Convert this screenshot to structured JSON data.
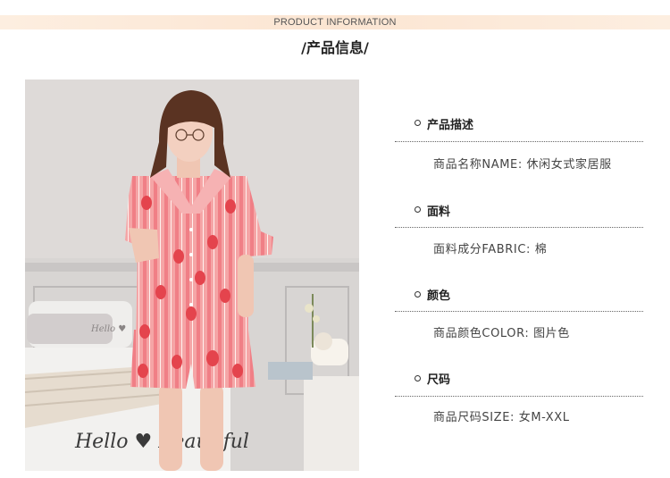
{
  "header": {
    "band_label": "PRODUCT INFORMATION",
    "title": "/产品信息/"
  },
  "photo": {
    "pillow_text": "Hello ♥",
    "blanket_text": "Hello ♥ Beautiful"
  },
  "sections": [
    {
      "heading": "产品描述",
      "value": "商品名称NAME: 休闲女式家居服"
    },
    {
      "heading": "面料",
      "value": "面料成分FABRIC: 棉"
    },
    {
      "heading": "颜色",
      "value": "商品颜色COLOR: 图片色"
    },
    {
      "heading": "尺码",
      "value": "商品尺码SIZE: 女M-XXL"
    }
  ],
  "colors": {
    "band": "#fbe5d2",
    "pajama_pink": "#f29a9e",
    "strawberry": "#e4444d"
  }
}
